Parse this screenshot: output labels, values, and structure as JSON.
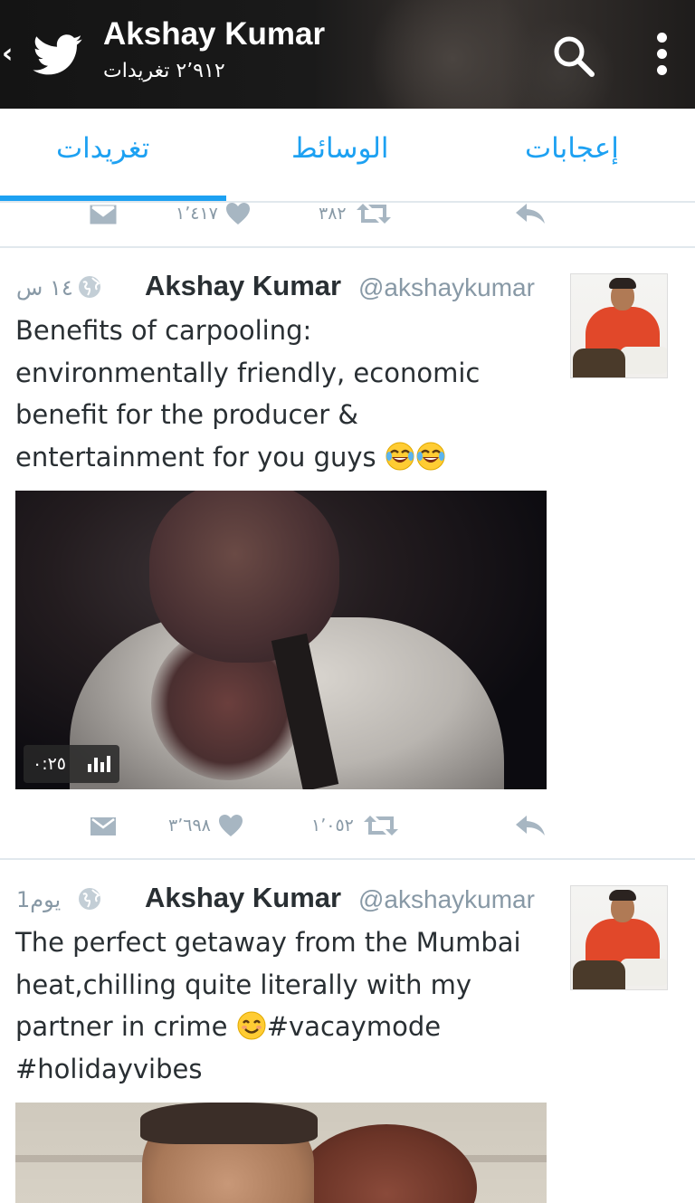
{
  "header": {
    "name": "Akshay Kumar",
    "tweet_count": "٢٬٩١٢ تغريدات",
    "back_glyph": "‹"
  },
  "tabs": [
    {
      "label": "تغريدات",
      "active": true
    },
    {
      "label": "الوسائط",
      "active": false
    },
    {
      "label": "إعجابات",
      "active": false
    }
  ],
  "colors": {
    "accent": "#1da1f2",
    "muted": "#8899a6",
    "text": "#292f33",
    "divider": "#e1e8ed"
  },
  "top_actions": {
    "likes": "١٬٤١٧",
    "retweets": "٣٨٢"
  },
  "tweets": [
    {
      "author": "Akshay Kumar",
      "handle": "@akshaykumar",
      "time": "١٤ س",
      "text": "Benefits of carpooling:\nenvironmentally friendly, economic\nbenefit for the producer &\nentertainment for you guys ",
      "emoji": [
        "face-with-tears-of-joy",
        "face-with-tears-of-joy"
      ],
      "media": {
        "type": "video",
        "duration": "٠:٢٥"
      },
      "actions": {
        "likes": "٣٬٦٩٨",
        "retweets": "١٬٠٥٢"
      }
    },
    {
      "author": "Akshay Kumar",
      "handle": "@akshaykumar",
      "time": "1يوم",
      "text_line1": "The perfect getaway from the Mumbai",
      "text_line2": "heat,chilling quite literally with my",
      "text_line3a": "partner in crime ",
      "text_line3b": "#vacaymode",
      "text_line4": "#holidayvibes",
      "emoji": [
        "smiling-face-with-smiling-eyes"
      ],
      "media": {
        "type": "photo"
      }
    }
  ]
}
